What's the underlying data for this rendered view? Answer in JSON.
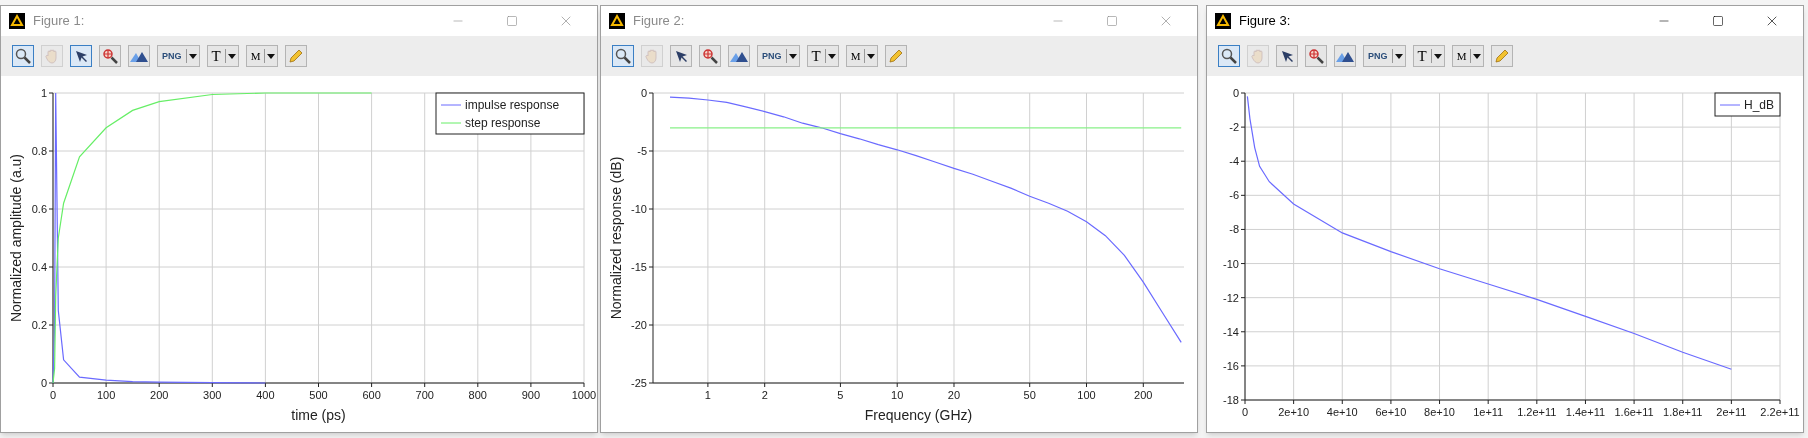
{
  "windows": [
    {
      "title": "Figure 1:",
      "active": false,
      "toolbar": [
        {
          "kind": "zoom",
          "selected": true,
          "disabled": false
        },
        {
          "kind": "pan",
          "selected": false,
          "disabled": true
        },
        {
          "kind": "select",
          "selected": true,
          "disabled": false
        },
        {
          "kind": "zoom-region",
          "selected": false,
          "disabled": false
        },
        {
          "kind": "mountains",
          "selected": false,
          "disabled": false
        },
        {
          "kind": "export",
          "label": "PNG",
          "selected": false,
          "disabled": false
        },
        {
          "kind": "text",
          "label": "T",
          "selected": false,
          "disabled": false
        },
        {
          "kind": "marker",
          "label": "M",
          "selected": false,
          "disabled": false
        },
        {
          "kind": "pencil",
          "selected": false,
          "disabled": false
        }
      ],
      "chart_data": {
        "type": "line",
        "xlabel": "time (ps)",
        "ylabel": "Normalized amplitude (a.u)",
        "x": [
          0,
          3,
          5,
          10,
          20,
          50,
          100,
          150,
          200,
          300,
          400,
          600
        ],
        "series": [
          {
            "name": "impulse response",
            "color": "#6a6aff",
            "values": [
              0,
              0.2,
              1,
              0.25,
              0.08,
              0.02,
              0.01,
              0.005,
              0.003,
              0.001,
              0,
              null
            ]
          },
          {
            "name": "step response",
            "color": "#66ee66",
            "values": [
              0,
              0.05,
              0.3,
              0.5,
              0.62,
              0.78,
              0.88,
              0.94,
              0.97,
              0.995,
              1,
              1
            ]
          }
        ],
        "grid": true,
        "legend": true,
        "xlim": [
          0,
          1000
        ],
        "ylim": [
          0,
          1
        ],
        "xticks": [
          0,
          100,
          200,
          300,
          400,
          500,
          600,
          700,
          800,
          900,
          1000
        ],
        "yticks": [
          0,
          0.2,
          0.4,
          0.6,
          0.8,
          1
        ]
      }
    },
    {
      "title": "Figure 2:",
      "active": false,
      "toolbar": [
        {
          "kind": "zoom",
          "selected": true,
          "disabled": false
        },
        {
          "kind": "pan",
          "selected": false,
          "disabled": true
        },
        {
          "kind": "select",
          "selected": false,
          "disabled": false
        },
        {
          "kind": "zoom-region",
          "selected": false,
          "disabled": false
        },
        {
          "kind": "mountains",
          "selected": false,
          "disabled": false
        },
        {
          "kind": "export",
          "label": "PNG",
          "selected": false,
          "disabled": false
        },
        {
          "kind": "text",
          "label": "T",
          "selected": false,
          "disabled": false
        },
        {
          "kind": "marker",
          "label": "M",
          "selected": false,
          "disabled": false
        },
        {
          "kind": "pencil",
          "selected": false,
          "disabled": false
        }
      ],
      "chart_data": {
        "type": "line",
        "xlabel": "Frequency (GHz)",
        "ylabel": "Normalized response (dB)",
        "grid": true,
        "categories": [
          null,
          null,
          null,
          "1",
          null,
          null,
          "2",
          null,
          null,
          null,
          "5",
          null,
          null,
          "10",
          null,
          null,
          "20",
          null,
          null,
          null,
          "50",
          null,
          null,
          "100",
          null,
          null,
          "200",
          null,
          null
        ],
        "series": [
          {
            "color": "#6a6aff",
            "values": [
              null,
              -0.35,
              -0.45,
              -0.6,
              -0.8,
              -1.2,
              -1.6,
              -2.05,
              -2.6,
              -3.0,
              -3.5,
              -3.95,
              -4.45,
              -4.9,
              -5.4,
              -5.95,
              -6.5,
              -7.0,
              -7.6,
              -8.2,
              -8.9,
              -9.5,
              -10.2,
              -11.1,
              -12.3,
              -14.0,
              -16.3,
              -18.9,
              -21.5
            ]
          },
          {
            "color": "#88f088",
            "values": [
              null,
              -3,
              -3,
              -3,
              -3,
              -3,
              -3,
              -3,
              -3,
              -3,
              -3,
              -3,
              -3,
              -3,
              -3,
              -3,
              -3,
              -3,
              -3,
              -3,
              -3,
              -3,
              -3,
              -3,
              -3,
              -3,
              -3,
              -3,
              -3
            ]
          }
        ],
        "ylim": [
          -25,
          0
        ],
        "yticks": [
          -25,
          -20,
          -15,
          -10,
          -5,
          0
        ]
      }
    },
    {
      "title": "Figure 3:",
      "active": true,
      "toolbar": [
        {
          "kind": "zoom",
          "selected": true,
          "disabled": false
        },
        {
          "kind": "pan",
          "selected": false,
          "disabled": true
        },
        {
          "kind": "select",
          "selected": false,
          "disabled": false
        },
        {
          "kind": "zoom-region",
          "selected": false,
          "disabled": false
        },
        {
          "kind": "mountains",
          "selected": false,
          "disabled": false
        },
        {
          "kind": "export",
          "label": "PNG",
          "selected": false,
          "disabled": false
        },
        {
          "kind": "text",
          "label": "T",
          "selected": false,
          "disabled": false
        },
        {
          "kind": "marker",
          "label": "M",
          "selected": false,
          "disabled": false
        },
        {
          "kind": "pencil",
          "selected": false,
          "disabled": false
        }
      ],
      "chart_data": {
        "type": "line",
        "x": [
          1000000000.0,
          2000000000.0,
          4000000000.0,
          6000000000.0,
          10000000000.0,
          20000000000.0,
          40000000000.0,
          60000000000.0,
          80000000000.0,
          100000000000.0,
          120000000000.0,
          140000000000.0,
          160000000000.0,
          180000000000.0,
          200000000000.0
        ],
        "series": [
          {
            "name": "H_dB",
            "color": "#6a6aff",
            "values": [
              -0.2,
              -1.5,
              -3.2,
              -4.3,
              -5.2,
              -6.5,
              -8.2,
              -9.3,
              -10.3,
              -11.2,
              -12.1,
              -13.1,
              -14.1,
              -15.2,
              -16.2
            ]
          }
        ],
        "grid": true,
        "legend": true,
        "xlim": [
          0,
          220000000000.0
        ],
        "ylim": [
          -18,
          0
        ],
        "xticks": [
          {
            "value": 0,
            "label": "0"
          },
          {
            "value": 20000000000.0,
            "label": "2e+10"
          },
          {
            "value": 40000000000.0,
            "label": "4e+10"
          },
          {
            "value": 60000000000.0,
            "label": "6e+10"
          },
          {
            "value": 80000000000.0,
            "label": "8e+10"
          },
          {
            "value": 100000000000.0,
            "label": "1e+11"
          },
          {
            "value": 120000000000.0,
            "label": "1.2e+11"
          },
          {
            "value": 140000000000.0,
            "label": "1.4e+11"
          },
          {
            "value": 160000000000.0,
            "label": "1.6e+11"
          },
          {
            "value": 180000000000.0,
            "label": "1.8e+11"
          },
          {
            "value": 200000000000.0,
            "label": "2e+11"
          },
          {
            "value": 220000000000.0,
            "label": "2.2e+11"
          }
        ],
        "yticks": [
          -18,
          -16,
          -14,
          -12,
          -10,
          -8,
          -6,
          -4,
          -2,
          0
        ]
      }
    }
  ]
}
